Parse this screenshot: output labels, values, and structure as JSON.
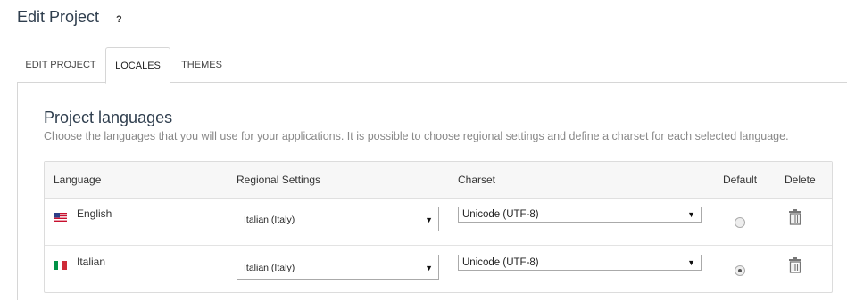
{
  "header": {
    "title": "Edit Project",
    "help": "?"
  },
  "tabs": [
    {
      "label": "EDIT PROJECT",
      "active": false
    },
    {
      "label": "LOCALES",
      "active": true
    },
    {
      "label": "THEMES",
      "active": false
    }
  ],
  "section": {
    "title": "Project languages",
    "description": "Choose the languages that you will use for your applications. It is possible to choose regional settings and define a charset for each selected language."
  },
  "table": {
    "headers": {
      "language": "Language",
      "regional": "Regional Settings",
      "charset": "Charset",
      "default": "Default",
      "delete": "Delete"
    },
    "rows": [
      {
        "language": "English",
        "flag": "us-flag-icon",
        "regional": "Italian (Italy)",
        "charset": "Unicode (UTF-8)",
        "default": false
      },
      {
        "language": "Italian",
        "flag": "italy-flag-icon",
        "regional": "Italian (Italy)",
        "charset": "Unicode (UTF-8)",
        "default": true
      }
    ]
  },
  "icons": {
    "delete": "trash-icon",
    "dropdown": "triangle-down-icon"
  },
  "colors": {
    "title": "#2f3e4e",
    "description": "#888888",
    "border": "#d6d6d6",
    "header_bg": "#f7f7f7"
  }
}
